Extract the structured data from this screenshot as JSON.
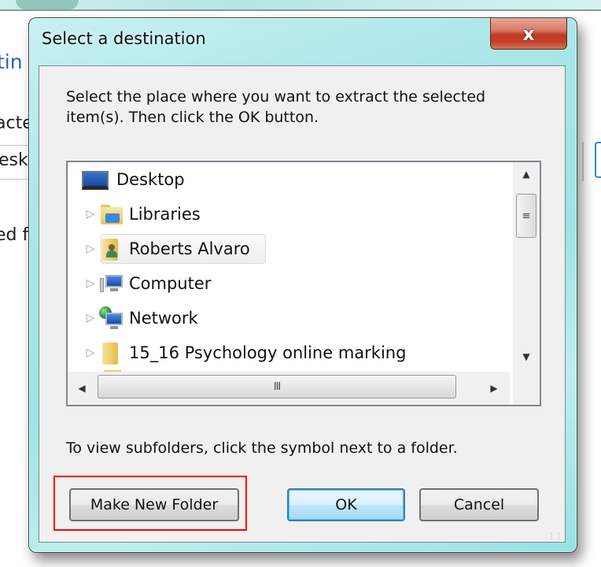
{
  "background_window": {
    "heading_fragment": "tin",
    "label_fragment_1": "acte",
    "field_fragment": "eskt",
    "label_fragment_2": "ed f"
  },
  "dialog": {
    "title": "Select a destination",
    "close_glyph": "x",
    "instruction": "Select the place where you want to extract the selected item(s).  Then click the OK button.",
    "hint": "To view subfolders, click the symbol next to a folder.",
    "tree": {
      "items": [
        {
          "label": "Desktop",
          "icon": "desktop-icon",
          "expandable": false,
          "selected": false,
          "level": 0
        },
        {
          "label": "Libraries",
          "icon": "libraries-icon",
          "expandable": true,
          "selected": false,
          "level": 1
        },
        {
          "label": "Roberts Alvaro",
          "icon": "user-folder-icon",
          "expandable": true,
          "selected": true,
          "level": 1
        },
        {
          "label": "Computer",
          "icon": "computer-icon",
          "expandable": true,
          "selected": false,
          "level": 1
        },
        {
          "label": "Network",
          "icon": "network-icon",
          "expandable": true,
          "selected": false,
          "level": 1
        },
        {
          "label": "15_16 Psychology online marking",
          "icon": "folder-icon",
          "expandable": true,
          "selected": false,
          "level": 1
        }
      ],
      "expander_glyph": "▷",
      "scroll_up_glyph": "▲",
      "scroll_down_glyph": "▼",
      "scroll_left_glyph": "◀",
      "scroll_right_glyph": "▶",
      "vthumb_grip": "≡",
      "hthumb_grip": "III"
    },
    "buttons": {
      "make_new_folder": "Make New Folder",
      "ok": "OK",
      "cancel": "Cancel"
    },
    "annotation": {
      "highlight_color": "#ff0000",
      "highlighted_element": "Make New Folder"
    }
  }
}
